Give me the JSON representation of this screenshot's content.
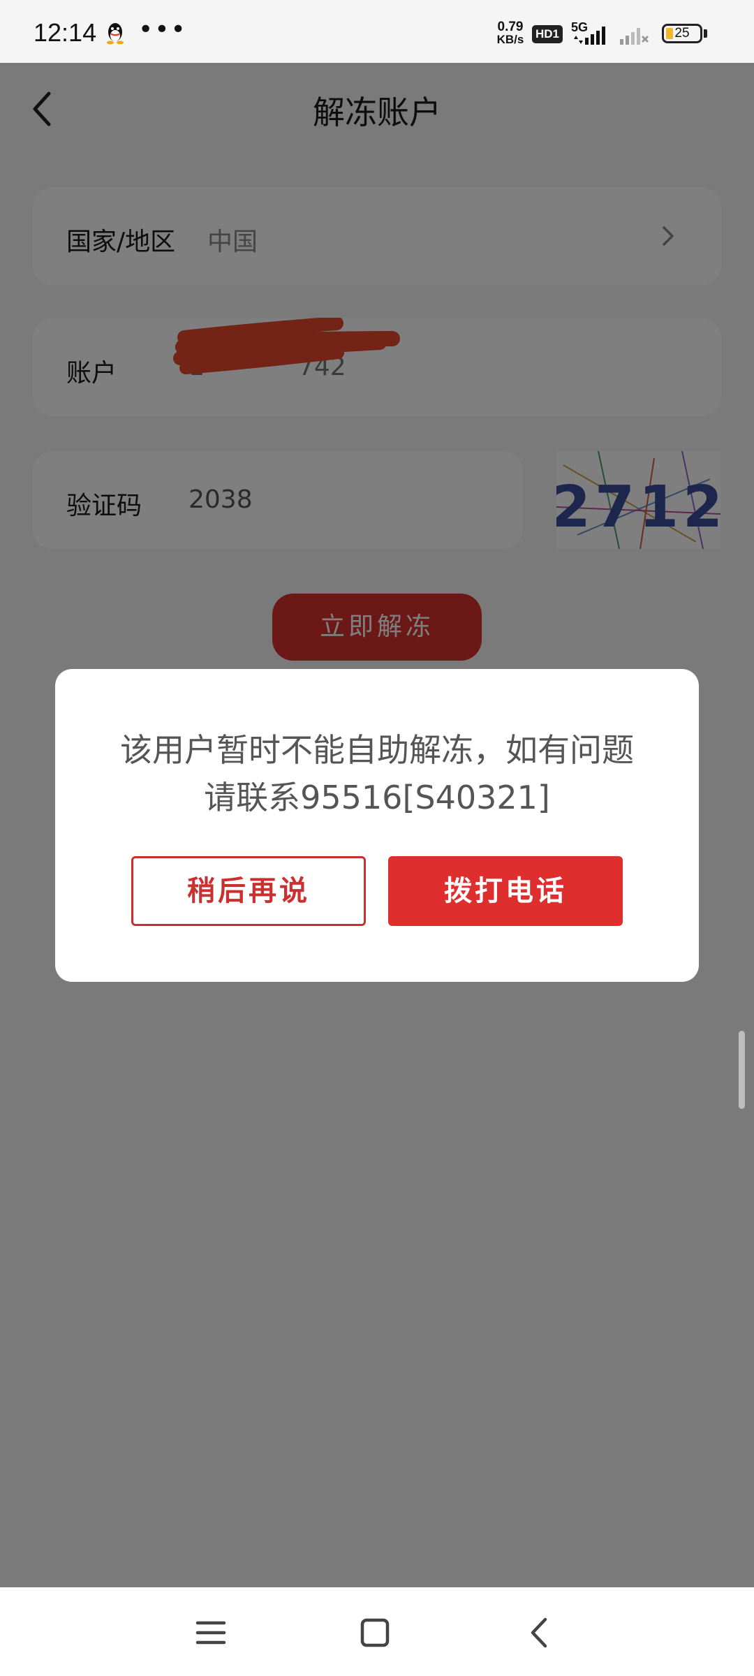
{
  "status_bar": {
    "time": "12:14",
    "net_speed_value": "0.79",
    "net_speed_unit": "KB/s",
    "hd_badge": "HD1",
    "network_type": "5G",
    "battery_level": "25",
    "icons": [
      "qq-icon",
      "more-dots-icon",
      "signal-icon",
      "signal-weak-icon",
      "battery-icon"
    ]
  },
  "header": {
    "title": "解冻账户",
    "back_icon": "chevron-left-icon"
  },
  "form": {
    "country_label": "国家/地区",
    "country_value": "中国",
    "account_label": "账户",
    "account_value_visible": "1",
    "account_value_tail": "742",
    "captcha_label": "验证码",
    "captcha_value": "2038",
    "captcha_image_text": "2712",
    "submit_label": "立即解冻"
  },
  "dialog": {
    "message_line1": "该用户暂时不能自助解冻，如有问题",
    "message_line2": "请联系95516[S40321]",
    "later_button": "稍后再说",
    "call_button": "拨打电话"
  },
  "nav_bar": {
    "icons": [
      "menu-icon",
      "home-icon",
      "back-icon"
    ]
  },
  "colors": {
    "accent_red": "#de2e2e",
    "overlay": "rgba(0,0,0,0.5)",
    "redaction": "#e8472e"
  }
}
